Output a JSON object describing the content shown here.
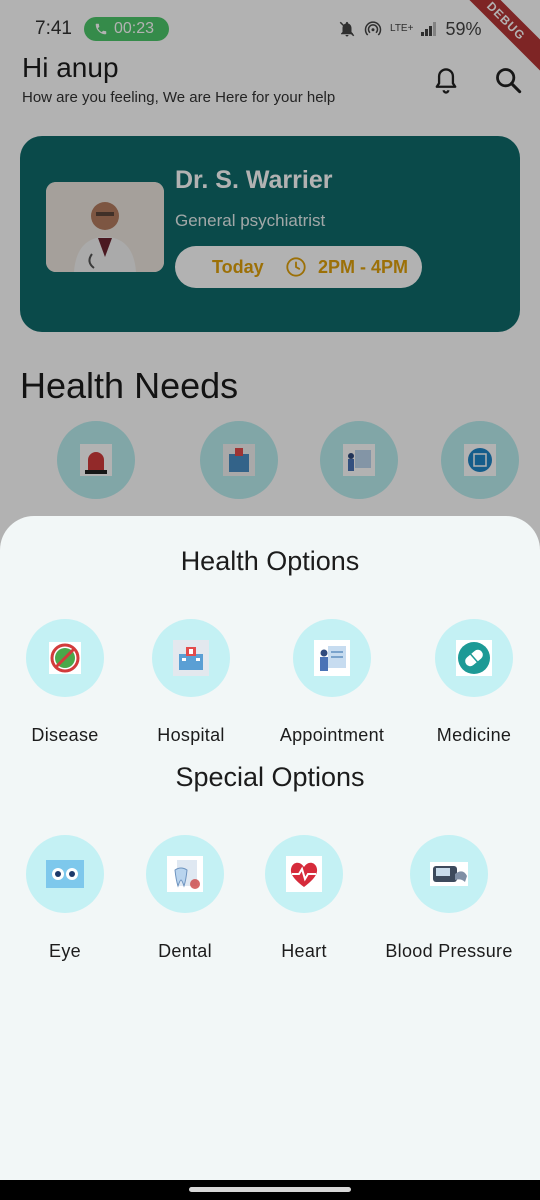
{
  "status_bar": {
    "time": "7:41",
    "call_timer": "00:23",
    "network_lte": "LTE+",
    "battery": "59%",
    "debug_label": "DEBUG"
  },
  "header": {
    "greeting": "Hi anup",
    "subtitle": "How are you feeling, We are Here for your help",
    "icons": [
      "bell-icon",
      "search-icon"
    ]
  },
  "doctor_card": {
    "name": "Dr. S. Warrier",
    "specialty": "General psychiatrist",
    "day": "Today",
    "time": "2PM - 4PM",
    "colors": {
      "card": "#0f6b6b",
      "accent": "#e0a10b"
    }
  },
  "health_needs": {
    "title": "Health Needs",
    "items": [
      "emergency-siren-icon",
      "hospital-icon",
      "appointment-icon",
      "medicine-icon"
    ]
  },
  "sheet": {
    "health_options_title": "Health Options",
    "health_options": [
      {
        "label": "Disease",
        "icon": "virus-icon"
      },
      {
        "label": "Hospital",
        "icon": "hospital-icon"
      },
      {
        "label": "Appointment",
        "icon": "appointment-icon"
      },
      {
        "label": "Medicine",
        "icon": "pill-icon"
      }
    ],
    "special_options_title": "Special Options",
    "special_options": [
      {
        "label": "Eye",
        "icon": "eyes-icon"
      },
      {
        "label": "Dental",
        "icon": "tooth-icon"
      },
      {
        "label": "Heart",
        "icon": "heart-icon"
      },
      {
        "label": "Blood Pressure",
        "icon": "blood-pressure-monitor-icon"
      }
    ]
  }
}
